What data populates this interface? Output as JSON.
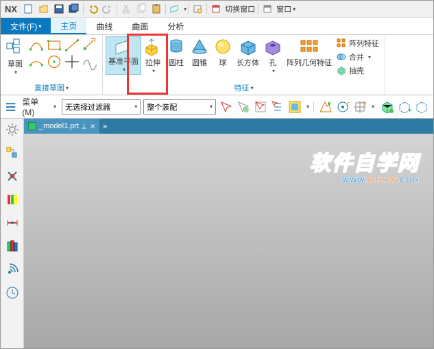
{
  "app": {
    "name": "NX"
  },
  "titlebar": {
    "switch_window": "切换窗口",
    "window": "窗口"
  },
  "tabs": {
    "file": "文件(F)",
    "home": "主页",
    "curve": "曲线",
    "surface": "曲面",
    "analysis": "分析"
  },
  "ribbon": {
    "sketch": {
      "label": "草图",
      "group": "直接草图"
    },
    "datum": {
      "label": "基准平面"
    },
    "features_group": "特征",
    "extrude": "拉伸",
    "cylinder": "圆柱",
    "cone": "圆锥",
    "sphere": "球",
    "block": "长方体",
    "hole": "孔",
    "pattern_geom": "阵列几何特征",
    "pattern_feat": "阵列特征",
    "combine": "合并",
    "shell": "抽壳"
  },
  "selbar": {
    "menu": "菜单(M)",
    "filter": "无选择过滤器",
    "assembly": "整个装配"
  },
  "document": {
    "name": "_model1.prt"
  },
  "watermark": {
    "cn": "软件自学网",
    "en_a": "WWW.",
    "en_b": "RJZXW",
    "en_c": ".COM"
  }
}
